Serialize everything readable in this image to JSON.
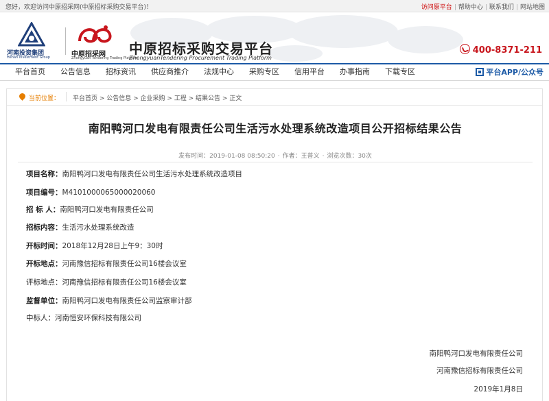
{
  "topbar": {
    "welcome": "您好，欢迎访问中原招采网(中原招标采购交易平台)！",
    "links": [
      "访问原平台",
      "帮助中心",
      "联系我们",
      "网站地图"
    ]
  },
  "header": {
    "logo1_name": "河南投资集团",
    "logo1_sub": "Henan Investment Group",
    "logo2_name": "中原招采网",
    "logo2_sub": "Zhongyuan Tendering Trading Platform",
    "title": "中原招标采购交易平台",
    "subtitle": "ZhongyuanTendering Procurement Trading Platform",
    "hotline": "400-8371-211"
  },
  "nav": {
    "items": [
      "平台首页",
      "公告信息",
      "招标资讯",
      "供应商推介",
      "法规中心",
      "采购专区",
      "信用平台",
      "办事指南",
      "下载专区"
    ],
    "app": "平台APP/公众号"
  },
  "breadcrumb": {
    "label": "当前位置：",
    "path": "平台首页 > 公告信息 > 企业采购 > 工程 > 结果公告 > 正文"
  },
  "article": {
    "title": "南阳鸭河口发电有限责任公司生活污水处理系统改造项目公开招标结果公告",
    "publish_time": "发布时间：2019-01-08 08:50:20",
    "author": "作者：王普义",
    "views": "浏览次数：30次",
    "fields": [
      {
        "key": "项目名称：",
        "value": "南阳鸭河口发电有限责任公司生活污水处理系统改造项目"
      },
      {
        "key": "项目编号：",
        "value": "M4101000065000020060"
      },
      {
        "key": "招 标 人：",
        "value": "南阳鸭河口发电有限责任公司"
      },
      {
        "key": "招标内容：",
        "value": "生活污水处理系统改造"
      },
      {
        "key": "开标时间：",
        "value": "2018年12月28日上午9：30时"
      },
      {
        "key": "开标地点：",
        "value": "河南豫信招标有限责任公司16楼会议室"
      },
      {
        "key": "评标地点：",
        "value": "河南豫信招标有限责任公司16楼会议室"
      },
      {
        "key": "监督单位：",
        "value": "南阳鸭河口发电有限责任公司监察审计部"
      },
      {
        "key": "中标人：",
        "value": "河南恒安环保科技有限公司"
      }
    ],
    "signature": [
      "南阳鸭河口发电有限责任公司",
      "河南豫信招标有限责任公司",
      "2019年1月8日"
    ]
  }
}
